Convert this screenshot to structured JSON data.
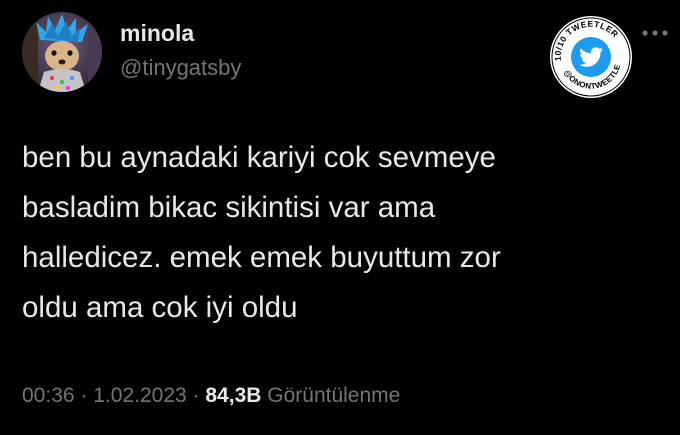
{
  "tweet": {
    "author": {
      "display_name": "minola",
      "handle": "@tinygatsby",
      "avatar_icon": "dog-with-blue-hair-avatar"
    },
    "badge": {
      "top_text": "10/10 TWEETLER",
      "bottom_text": "@ONONTWEETLER",
      "icon": "twitter-bird-icon",
      "color": "#1d9bf0"
    },
    "text": "ben bu aynadaki kariyi cok sevmeye\nbasladim bikac sikintisi var ama\nhalledicez. emek emek buyuttum zor\noldu ama cok iyi oldu",
    "meta": {
      "time": "00:36",
      "separator": "·",
      "date": "1.02.2023",
      "views_count": "84,3B",
      "views_label": "Görüntülenme"
    }
  },
  "colors": {
    "background": "#000000",
    "primary_text": "#e7e9ea",
    "secondary_text": "#71767b",
    "accent": "#1d9bf0"
  }
}
